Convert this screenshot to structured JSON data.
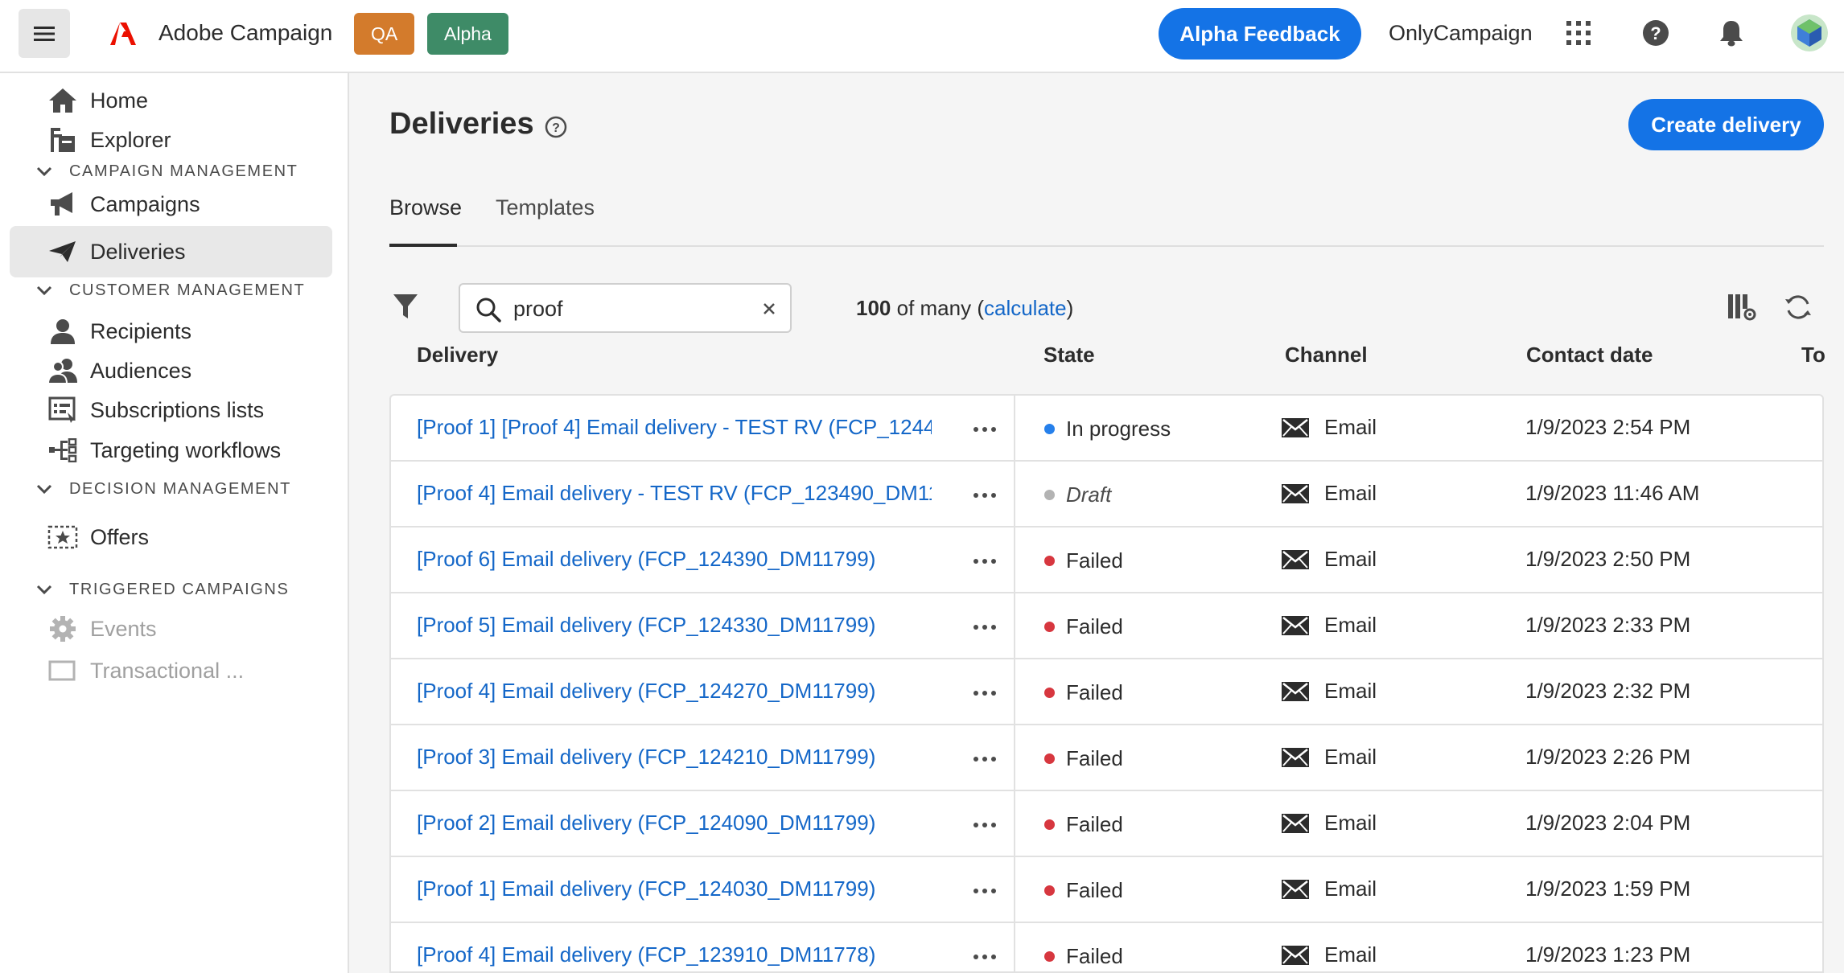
{
  "topbar": {
    "app_name": "Adobe Campaign",
    "badge_qa": "QA",
    "badge_alpha": "Alpha",
    "feedback_label": "Alpha Feedback",
    "org_name": "OnlyCampaign",
    "brand_color": "#eb1000",
    "accent_color": "#1473e6",
    "icons": [
      "menu-icon",
      "adobe-logo",
      "apps-grid-icon",
      "help-icon",
      "bell-icon",
      "avatar"
    ]
  },
  "sidebar": {
    "items": [
      {
        "label": "Home",
        "icon": "home-icon"
      },
      {
        "label": "Explorer",
        "icon": "explorer-icon"
      },
      {
        "label": "Campaigns",
        "icon": "megaphone-icon"
      },
      {
        "label": "Deliveries",
        "icon": "send-icon",
        "active": true
      },
      {
        "label": "Recipients",
        "icon": "user-icon"
      },
      {
        "label": "Audiences",
        "icon": "users-icon"
      },
      {
        "label": "Subscriptions lists",
        "icon": "list-icon"
      },
      {
        "label": "Targeting workflows",
        "icon": "workflow-icon"
      },
      {
        "label": "Offers",
        "icon": "offer-icon"
      },
      {
        "label": "Events",
        "icon": "gear-icon",
        "disabled": true
      },
      {
        "label": "Transactional ...",
        "icon": "transactional-icon",
        "disabled": true
      }
    ],
    "sections": [
      {
        "label": "CAMPAIGN MANAGEMENT"
      },
      {
        "label": "CUSTOMER MANAGEMENT"
      },
      {
        "label": "DECISION MANAGEMENT"
      },
      {
        "label": "TRIGGERED CAMPAIGNS"
      }
    ]
  },
  "main": {
    "title": "Deliveries",
    "create_label": "Create delivery",
    "tabs": [
      {
        "label": "Browse",
        "active": true
      },
      {
        "label": "Templates"
      }
    ],
    "search": {
      "value": "proof",
      "placeholder": "Search"
    },
    "count": {
      "number": "100",
      "suffix": " of many (",
      "link": "calculate",
      "close": ")"
    },
    "columns": [
      "Delivery",
      "State",
      "Channel",
      "Contact date",
      "To"
    ],
    "state_colors": {
      "In progress": "#2680eb",
      "Draft": "#b3b3b3",
      "Failed": "#d7373f"
    },
    "rows": [
      {
        "name": "[Proof 1] [Proof 4] Email delivery - TEST RV (FCP_1244...",
        "state": "In progress",
        "channel": "Email",
        "date": "1/9/2023 2:54 PM"
      },
      {
        "name": "[Proof 4] Email delivery - TEST RV (FCP_123490_DM11...",
        "state": "Draft",
        "channel": "Email",
        "date": "1/9/2023 11:46 AM"
      },
      {
        "name": "[Proof 6] Email delivery (FCP_124390_DM11799)",
        "state": "Failed",
        "channel": "Email",
        "date": "1/9/2023 2:50 PM"
      },
      {
        "name": "[Proof 5] Email delivery (FCP_124330_DM11799)",
        "state": "Failed",
        "channel": "Email",
        "date": "1/9/2023 2:33 PM"
      },
      {
        "name": "[Proof 4] Email delivery (FCP_124270_DM11799)",
        "state": "Failed",
        "channel": "Email",
        "date": "1/9/2023 2:32 PM"
      },
      {
        "name": "[Proof 3] Email delivery (FCP_124210_DM11799)",
        "state": "Failed",
        "channel": "Email",
        "date": "1/9/2023 2:26 PM"
      },
      {
        "name": "[Proof 2] Email delivery (FCP_124090_DM11799)",
        "state": "Failed",
        "channel": "Email",
        "date": "1/9/2023 2:04 PM"
      },
      {
        "name": "[Proof 1] Email delivery (FCP_124030_DM11799)",
        "state": "Failed",
        "channel": "Email",
        "date": "1/9/2023 1:59 PM"
      },
      {
        "name": "[Proof 4] Email delivery (FCP_123910_DM11778)",
        "state": "Failed",
        "channel": "Email",
        "date": "1/9/2023 1:23 PM"
      }
    ]
  }
}
